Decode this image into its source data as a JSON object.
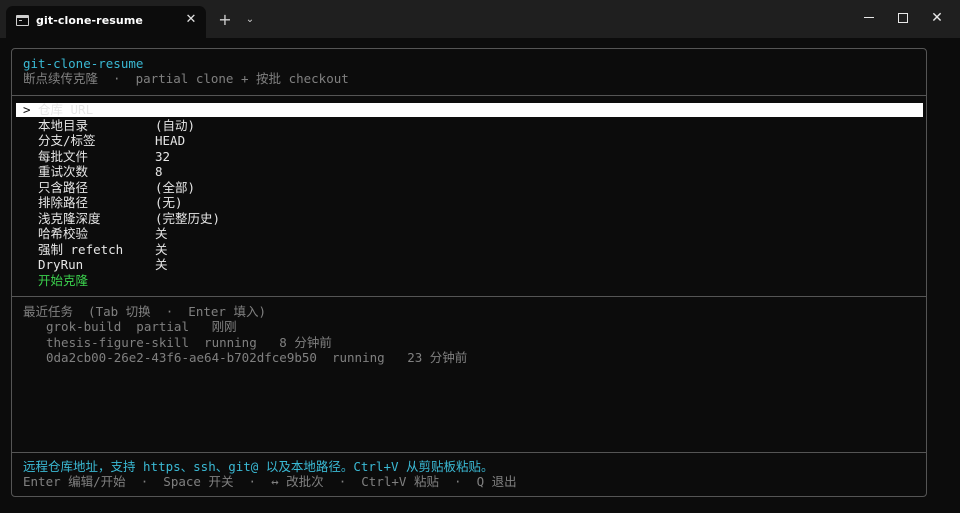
{
  "window": {
    "tab_title": "git-clone-resume",
    "tab_close": "✕",
    "new_tab": "+",
    "dropdown": "⌄",
    "close_glyph": "✕"
  },
  "header": {
    "title": "git-clone-resume",
    "subtitle": "断点续传克隆  ·  partial clone + 按批 checkout"
  },
  "menu": {
    "cursor": ">",
    "items": [
      {
        "label": "仓库 URL",
        "value": ""
      },
      {
        "label": "本地目录",
        "value": "(自动)"
      },
      {
        "label": "分支/标签",
        "value": "HEAD"
      },
      {
        "label": "每批文件",
        "value": "32"
      },
      {
        "label": "重试次数",
        "value": "8"
      },
      {
        "label": "只含路径",
        "value": "(全部)"
      },
      {
        "label": "排除路径",
        "value": "(无)"
      },
      {
        "label": "浅克隆深度",
        "value": "(完整历史)"
      },
      {
        "label": "哈希校验",
        "value": "关"
      },
      {
        "label": "强制 refetch",
        "value": "关"
      },
      {
        "label": "DryRun",
        "value": "关"
      }
    ],
    "start_label": "开始克隆"
  },
  "recent": {
    "header": "最近任务  (Tab 切换  ·  Enter 填入)",
    "rows": [
      "grok-build  partial   刚刚",
      "thesis-figure-skill  running   8 分钟前",
      "0da2cb00-26e2-43f6-ae64-b702dfce9b50  running   23 分钟前"
    ]
  },
  "footer": {
    "hint": "远程仓库地址，支持 https、ssh、git@ 以及本地路径。Ctrl+V 从剪贴板粘贴。",
    "keys": "Enter 编辑/开始  ·  Space 开关  ·  ↔ 改批次  ·  Ctrl+V 粘贴  ·  Q 退出"
  },
  "colors": {
    "accent_cyan": "#3ab9d4",
    "dim": "#808080",
    "start_green": "#3bd14d",
    "selection_bg": "#ffffff",
    "background": "#0c0c0c"
  }
}
